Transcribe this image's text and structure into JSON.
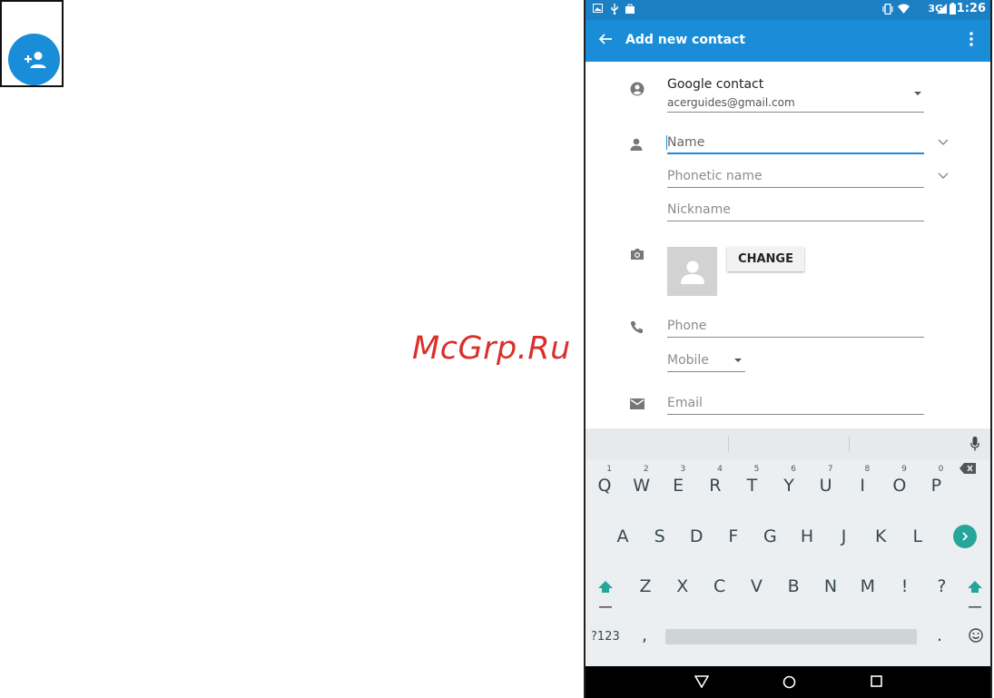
{
  "phone": {
    "status_bar": {
      "network": "3G",
      "time": "1:26"
    },
    "app_bar": {
      "title": "Add new contact"
    },
    "account": {
      "type": "Google contact",
      "email": "acerguides@gmail.com"
    },
    "fields": {
      "name_placeholder": "Name",
      "phonetic_placeholder": "Phonetic name",
      "nickname_placeholder": "Nickname",
      "phone_placeholder": "Phone",
      "phone_type": "Mobile",
      "email_placeholder": "Email"
    },
    "photo": {
      "change_label": "CHANGE"
    },
    "keyboard": {
      "row1": [
        {
          "k": "Q",
          "h": "1"
        },
        {
          "k": "W",
          "h": "2"
        },
        {
          "k": "E",
          "h": "3"
        },
        {
          "k": "R",
          "h": "4"
        },
        {
          "k": "T",
          "h": "5"
        },
        {
          "k": "Y",
          "h": "6"
        },
        {
          "k": "U",
          "h": "7"
        },
        {
          "k": "I",
          "h": "8"
        },
        {
          "k": "O",
          "h": "9"
        },
        {
          "k": "P",
          "h": "0"
        }
      ],
      "row2": [
        "A",
        "S",
        "D",
        "F",
        "G",
        "H",
        "J",
        "K",
        "L"
      ],
      "row3": [
        "Z",
        "X",
        "C",
        "V",
        "B",
        "N",
        "M",
        "!",
        "?"
      ],
      "symbols_label": "?123",
      "comma": ",",
      "period": "."
    }
  },
  "watermark": "McGrp.Ru",
  "colors": {
    "primary": "#1a8dd8",
    "status_bar": "#1b7fc4",
    "accent_key": "#26a69a"
  }
}
